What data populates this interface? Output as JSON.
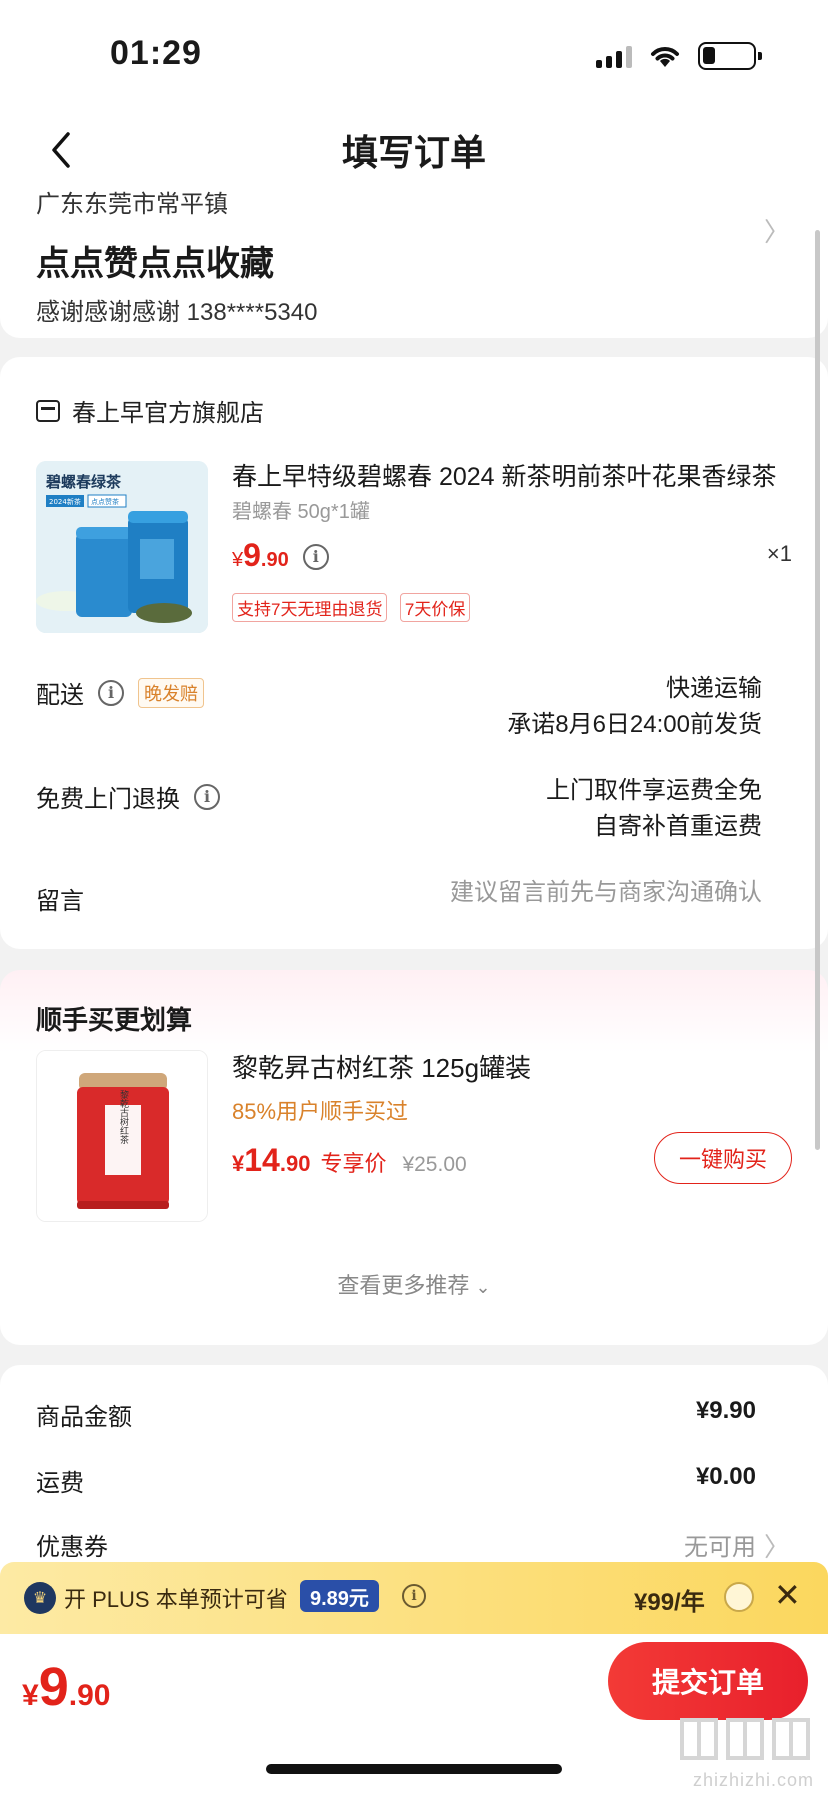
{
  "status_bar": {
    "time": "01:29"
  },
  "nav": {
    "title": "填写订单"
  },
  "address": {
    "region": "广东东莞市常平镇",
    "detail": "点点赞点点收藏",
    "contact": "感谢感谢感谢  138****5340"
  },
  "shop": {
    "name": "春上早官方旗舰店"
  },
  "product": {
    "title": "春上早特级碧螺春 2024 新茶明前茶叶花果香绿茶",
    "spec": "碧螺春 50g*1罐",
    "currency": "¥",
    "price_int": "9",
    "price_dec": ".90",
    "qty": "×1",
    "tags": [
      "支持7天无理由退货",
      "7天价保"
    ],
    "image_text": "碧螺春绿茶",
    "image_badges": [
      "2024新茶",
      "点点赞茶"
    ]
  },
  "delivery": {
    "label": "配送",
    "late_tag": "晚发赔",
    "method": "快递运输",
    "promise": "承诺8月6日24:00前发货"
  },
  "return_service": {
    "label": "免费上门退换",
    "line1": "上门取件享运费全免",
    "line2": "自寄补首重运费"
  },
  "message": {
    "label": "留言",
    "placeholder": "建议留言前先与商家沟通确认"
  },
  "recommend": {
    "title": "顺手买更划算",
    "name": "黎乾昇古树红茶 125g罐装",
    "meta": "85%用户顺手买过",
    "currency": "¥",
    "price_int": "14",
    "price_dec": ".90",
    "price_label": "专享价",
    "original_price": "¥25.00",
    "buy_label": "一键购买",
    "more_label": "查看更多推荐",
    "image_text": "黎乾古树红茶"
  },
  "summary": {
    "rows": [
      {
        "label": "商品金额",
        "value": "¥9.90"
      },
      {
        "label": "运费",
        "value": "¥0.00"
      },
      {
        "label": "优惠券",
        "value": "无可用"
      }
    ]
  },
  "plus": {
    "text": "开 PLUS 本单预计可省",
    "amount": "9.89元",
    "price": "¥99/年"
  },
  "footer": {
    "currency": "¥",
    "total_int": "9",
    "total_dec": ".90",
    "submit_label": "提交订单",
    "watermark": "zhizhizhi.com"
  },
  "colors": {
    "accent_red": "#e2231a",
    "plus_yellow": "#fbd75e",
    "plus_blue": "#2a4fa8",
    "orange_text": "#d9822b"
  },
  "icons": [
    "back-icon",
    "store-icon",
    "info-icon",
    "chevron-right-icon",
    "chevron-down-icon",
    "plus-logo-icon",
    "close-icon",
    "signal-icon",
    "wifi-icon",
    "battery-icon"
  ]
}
